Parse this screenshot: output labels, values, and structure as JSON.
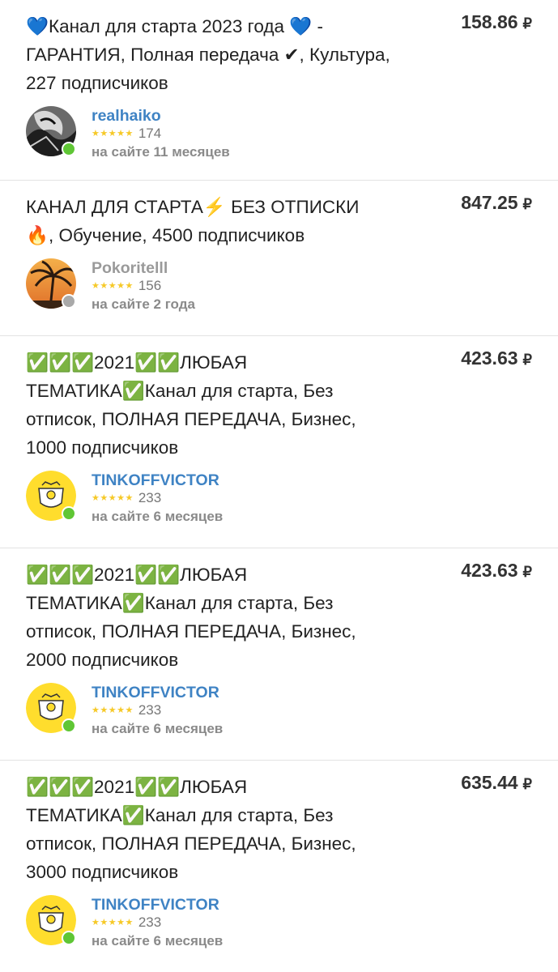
{
  "offers": [
    {
      "title": "💙Канал для старта 2023 года 💙 - ГАРАНТИЯ, Полная передача ✔, Культура, 227 подписчиков",
      "price": "158.86",
      "currency": "₽",
      "seller": {
        "name": "realhaiko",
        "stars": "★★★★★",
        "reviews": "174",
        "since": "на сайте 11 месяцев",
        "online": true,
        "avatar": "bw-art-avatar"
      }
    },
    {
      "title": "КАНАЛ ДЛЯ СТАРТА⚡ БЕЗ ОТПИСКИ 🔥, Обучение, 4500 подписчиков",
      "price": "847.25",
      "currency": "₽",
      "seller": {
        "name": "Pokoritelll",
        "stars": "★★★★★",
        "reviews": "156",
        "since": "на сайте 2 года",
        "online": false,
        "avatar": "palm-sunset-avatar"
      }
    },
    {
      "title": "✅✅✅2021✅✅ЛЮБАЯ ТЕМАТИКА✅Канал для старта, Без отписок, ПОЛНАЯ ПЕРЕДАЧА, Бизнес, 1000 подписчиков",
      "price": "423.63",
      "currency": "₽",
      "seller": {
        "name": "TINKOFFVICTOR",
        "stars": "★★★★★",
        "reviews": "233",
        "since": "на сайте 6 месяцев",
        "online": true,
        "avatar": "tinkoff-avatar"
      }
    },
    {
      "title": "✅✅✅2021✅✅ЛЮБАЯ ТЕМАТИКА✅Канал для старта, Без отписок, ПОЛНАЯ ПЕРЕДАЧА, Бизнес, 2000 подписчиков",
      "price": "423.63",
      "currency": "₽",
      "seller": {
        "name": "TINKOFFVICTOR",
        "stars": "★★★★★",
        "reviews": "233",
        "since": "на сайте 6 месяцев",
        "online": true,
        "avatar": "tinkoff-avatar"
      }
    },
    {
      "title": "✅✅✅2021✅✅ЛЮБАЯ ТЕМАТИКА✅Канал для старта, Без отписок, ПОЛНАЯ ПЕРЕДАЧА, Бизнес, 3000 подписчиков",
      "price": "635.44",
      "currency": "₽",
      "seller": {
        "name": "TINKOFFVICTOR",
        "stars": "★★★★★",
        "reviews": "233",
        "since": "на сайте 6 месяцев",
        "online": true,
        "avatar": "tinkoff-avatar"
      }
    }
  ],
  "colors": {
    "online": "#5fc635",
    "offline": "#a9a9a9",
    "link": "#3f83c4",
    "star": "#f6c928"
  }
}
